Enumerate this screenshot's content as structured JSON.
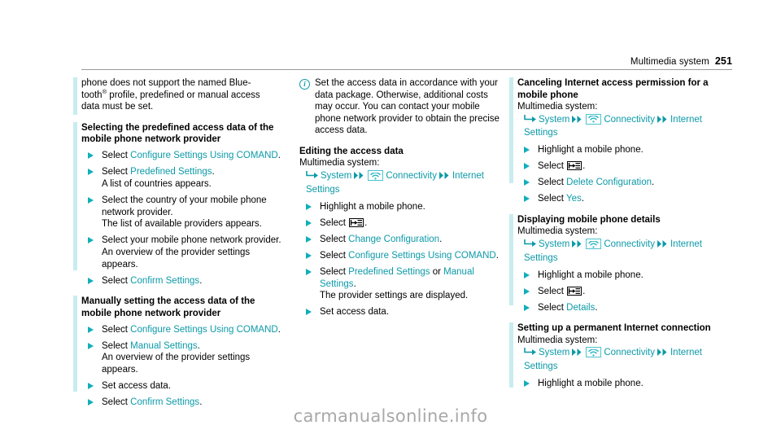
{
  "header": {
    "chapter": "Multimedia system",
    "page_number": "251"
  },
  "watermark": "carmanualsonline.info",
  "icons": {
    "info": "i",
    "path_arrow": "→",
    "path_separator": "▶▶",
    "wifi": "wifi-icon",
    "option_button": "back-to-list-icon"
  },
  "colors": {
    "accent_teal": "#0c9aa8",
    "marker_teal": "#11aebb",
    "changebar": "#c9ecef",
    "watermark_gray": "#a8a8a8"
  },
  "column_1": {
    "intro": {
      "text_1": "phone does not support the named Blue-",
      "text_2": "tooth",
      "superscript": "®",
      "text_3": " profile, predefined or manual access",
      "text_4": "data must be set."
    },
    "section_predefined": {
      "heading": "Selecting the predefined access data of the mobile phone network provider",
      "steps": [
        {
          "lead": "Select ",
          "ui": "Configure Settings Using COMAND",
          "tail": ".",
          "result": ""
        },
        {
          "lead": "Select ",
          "ui": "Predefined Settings",
          "tail": ".",
          "result": "A list of countries appears."
        },
        {
          "lead": "Select the country of your mobile phone network provider.",
          "ui": "",
          "tail": "",
          "result": "The list of available providers appears."
        },
        {
          "lead": "Select your mobile phone network provider.",
          "ui": "",
          "tail": "",
          "result": "An overview of the provider settings appears."
        },
        {
          "lead": "Select ",
          "ui": "Confirm Settings",
          "tail": ".",
          "result": ""
        }
      ]
    },
    "section_manual": {
      "heading": "Manually setting the access data of the mobile phone network provider",
      "steps": [
        {
          "lead": "Select ",
          "ui": "Configure Settings Using COMAND",
          "tail": ".",
          "result": ""
        },
        {
          "lead": "Select ",
          "ui": "Manual Settings",
          "tail": ".",
          "result": "An overview of the provider settings appears."
        },
        {
          "lead": "Set access data.",
          "ui": "",
          "tail": "",
          "result": ""
        },
        {
          "lead": "Select ",
          "ui": "Confirm Settings",
          "tail": ".",
          "result": ""
        }
      ]
    }
  },
  "column_2": {
    "note": "Set the access data in accordance with your data package. Otherwise, additional costs may occur. You can contact your mobile phone network provider to obtain the precise access data.",
    "section_editing": {
      "heading": "Editing the access data",
      "subheading": "Multimedia system:",
      "path": {
        "item_1": "System",
        "item_2": "Connectivity",
        "item_3": "Internet Settings"
      },
      "steps": [
        {
          "lead": "Highlight a mobile phone.",
          "ui": "",
          "tail": "",
          "result": ""
        },
        {
          "lead": "Select ",
          "ui": "",
          "icon": "option_button",
          "tail": ".",
          "result": ""
        },
        {
          "lead": "Select ",
          "ui": "Change Configuration",
          "tail": ".",
          "result": ""
        },
        {
          "lead": "Select ",
          "ui": "Configure Settings Using COMAND",
          "tail": ".",
          "result": ""
        },
        {
          "lead": "Select ",
          "ui": "Predefined Settings",
          "mid": " or ",
          "ui2": "Manual Settings",
          "tail": ".",
          "result": "The provider settings are displayed."
        },
        {
          "lead": "Set access data.",
          "ui": "",
          "tail": "",
          "result": ""
        }
      ]
    }
  },
  "column_3": {
    "section_canceling": {
      "heading": "Canceling Internet access permission for a mobile phone",
      "subheading": "Multimedia system:",
      "path": {
        "item_1": "System",
        "item_2": "Connectivity",
        "item_3": "Internet Settings"
      },
      "steps": [
        {
          "lead": "Highlight a mobile phone.",
          "ui": "",
          "tail": "",
          "result": ""
        },
        {
          "lead": "Select ",
          "ui": "",
          "icon": "option_button",
          "tail": ".",
          "result": ""
        },
        {
          "lead": "Select ",
          "ui": "Delete Configuration",
          "tail": ".",
          "result": ""
        },
        {
          "lead": "Select ",
          "ui": "Yes",
          "tail": ".",
          "result": ""
        }
      ]
    },
    "section_details": {
      "heading": "Displaying mobile phone details",
      "subheading": "Multimedia system:",
      "path": {
        "item_1": "System",
        "item_2": "Connectivity",
        "item_3": "Internet Settings"
      },
      "steps": [
        {
          "lead": "Highlight a mobile phone.",
          "ui": "",
          "tail": "",
          "result": ""
        },
        {
          "lead": "Select ",
          "ui": "",
          "icon": "option_button",
          "tail": ".",
          "result": ""
        },
        {
          "lead": "Select ",
          "ui": "Details",
          "tail": ".",
          "result": ""
        }
      ]
    },
    "section_permanent": {
      "heading": "Setting up a permanent Internet connection",
      "subheading": "Multimedia system:",
      "path": {
        "item_1": "System",
        "item_2": "Connectivity",
        "item_3": "Internet Settings"
      },
      "steps": [
        {
          "lead": "Highlight a mobile phone.",
          "ui": "",
          "tail": "",
          "result": ""
        }
      ]
    }
  }
}
